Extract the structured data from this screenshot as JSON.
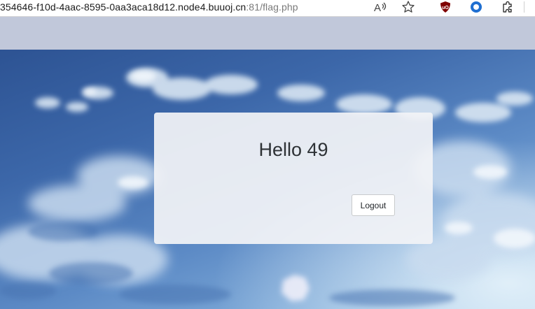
{
  "browser": {
    "url_host": "354646-f10d-4aac-8595-0aa3aca18d12.node4.buuoj.cn",
    "url_rest": ":81/flag.php",
    "icons": [
      "read-aloud-icon",
      "favorite-star-icon",
      "ublock-origin-icon",
      "browser-extension-ring-icon",
      "extensions-puzzle-icon"
    ],
    "ublock_color": "#800000"
  },
  "page": {
    "header_color": "#c1c8da",
    "greeting": "Hello 49",
    "logout_label": "Logout"
  }
}
